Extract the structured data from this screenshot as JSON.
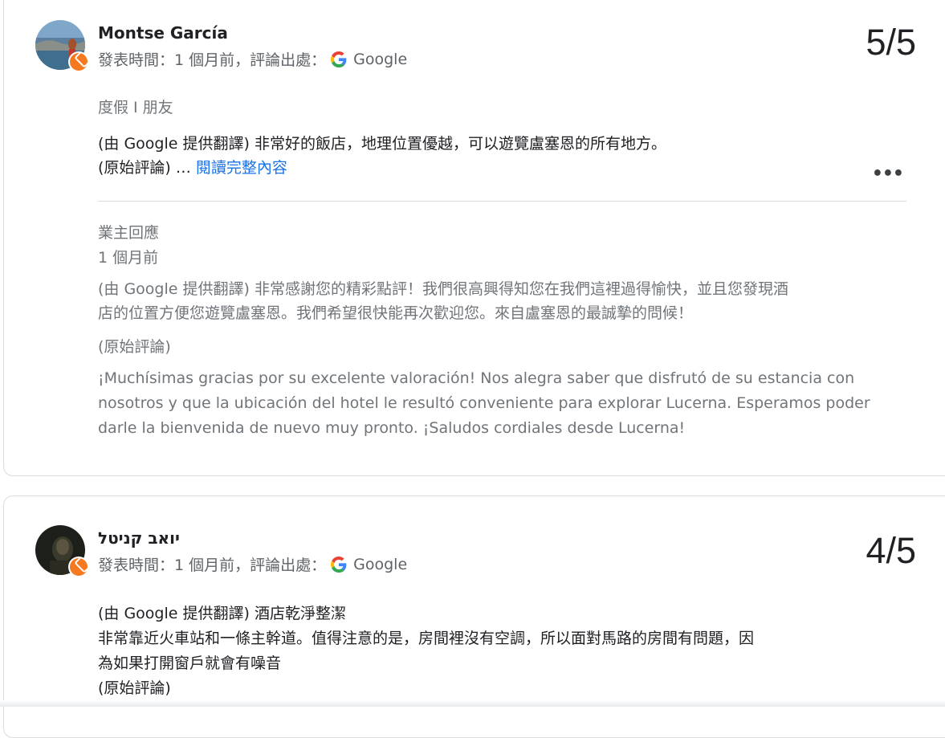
{
  "reviews": [
    {
      "name": "Montse García",
      "meta_prefix": "發表時間：1 個月前，評論出處：",
      "source": "Google",
      "score": "5/5",
      "trip_type": "度假 I 朋友",
      "translated": "(由 Google 提供翻譯) 非常好的飯店，地理位置優越，可以遊覽盧塞恩的所有地方。",
      "original_prefix": "(原始評論) … ",
      "read_more": "閱讀完整內容",
      "more_icon": "•••",
      "reply": {
        "title": "業主回應",
        "time": "1 個月前",
        "translated_line1": "(由 Google 提供翻譯) 非常感謝您的精彩點評！我們很高興得知您在我們這裡過得愉快，並且您發現酒",
        "translated_line2": "店的位置方便您遊覽盧塞恩。我們希望很快能再次歡迎您。來自盧塞恩的最誠摯的問候！",
        "original_label": "(原始評論)",
        "original_line1": "¡Muchísimas gracias por su excelente valoración! Nos alegra saber que disfrutó de su estancia con",
        "original_line2": "nosotros y que la ubicación del hotel le resultó conveniente para explorar Lucerna. Esperamos poder",
        "original_line3": "darle la bienvenida de nuevo muy pronto. ¡Saludos cordiales desde Lucerna!"
      }
    },
    {
      "name": "יואב קניטל",
      "meta_prefix": "發表時間：1 個月前，評論出處：",
      "source": "Google",
      "score": "4/5",
      "line1": "(由 Google 提供翻譯) 酒店乾淨整潔",
      "line2": "非常靠近火車站和一條主幹道。值得注意的是，房間裡沒有空調，所以面對馬路的房間有問題，因",
      "line3": "為如果打開窗戶就會有噪音",
      "line4": "(原始評論)"
    }
  ],
  "colors": {
    "accent": "#1a73e8",
    "badge": "#f4791f",
    "text": "#202124",
    "secondary": "#5f6368"
  }
}
